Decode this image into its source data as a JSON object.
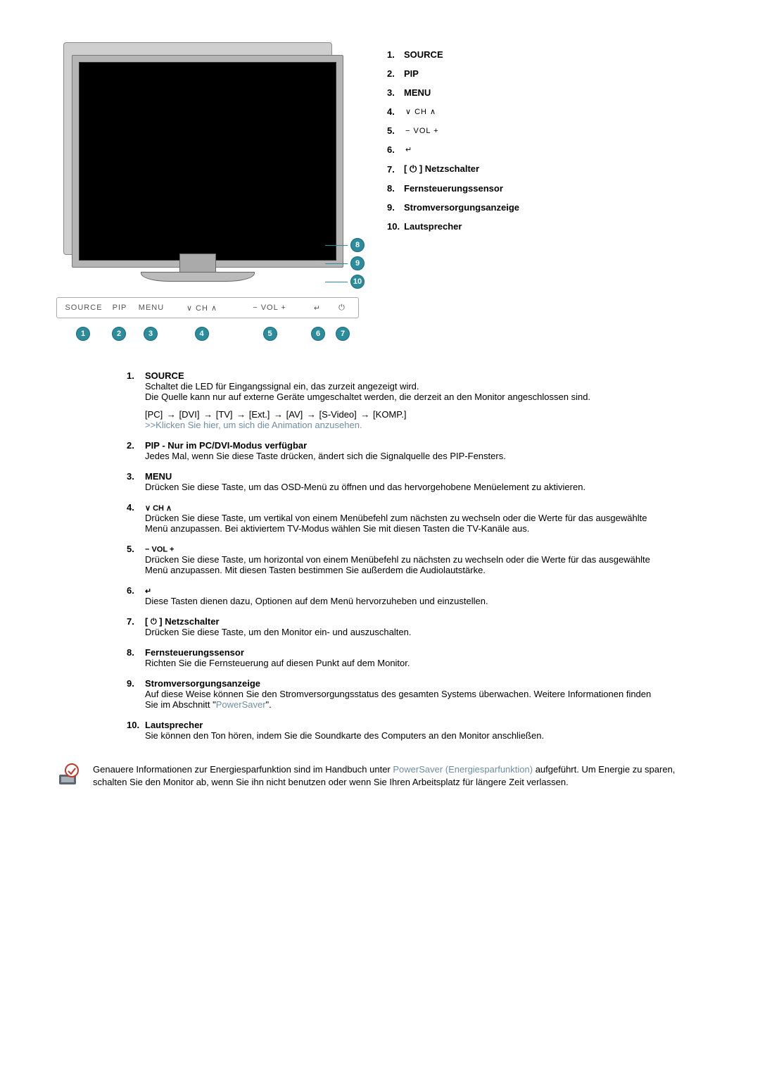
{
  "legend": {
    "items": [
      {
        "num": "1.",
        "label": "SOURCE",
        "bold": true
      },
      {
        "num": "2.",
        "label": "PIP",
        "bold": true
      },
      {
        "num": "3.",
        "label": "MENU",
        "bold": true
      },
      {
        "num": "4.",
        "label": "",
        "sym": "∨  CH  ∧"
      },
      {
        "num": "5.",
        "label": "",
        "sym": "−  VOL  +"
      },
      {
        "num": "6.",
        "label": "",
        "sym": "↵"
      },
      {
        "num": "7.",
        "label": "[  ⏻  ] Netzschalter",
        "bold": true,
        "hasPower": true
      },
      {
        "num": "8.",
        "label": "Fernsteuerungssensor",
        "bold": true
      },
      {
        "num": "9.",
        "label": "Stromversorgungsanzeige",
        "bold": true
      },
      {
        "num": "10.",
        "label": "Lautsprecher",
        "bold": true
      }
    ]
  },
  "panel": {
    "source": "SOURCE",
    "pip": "PIP",
    "menu": "MENU",
    "ch": "∨   CH   ∧",
    "vol": "−    VOL   +",
    "enter": "↵",
    "power": "⏻"
  },
  "badges": {
    "b1": "1",
    "b2": "2",
    "b3": "3",
    "b4": "4",
    "b5": "5",
    "b6": "6",
    "b7": "7",
    "b8": "8",
    "b9": "9",
    "b10": "10"
  },
  "desc": {
    "1": {
      "num": "1.",
      "title": "SOURCE",
      "l1": "Schaltet die LED für Eingangssignal ein, das zurzeit angezeigt wird.",
      "l2": "Die Quelle kann nur auf externe Geräte umgeschaltet werden, die derzeit an den Monitor angeschlossen sind.",
      "chain_pc": "[PC]",
      "chain_dvi": "[DVI]",
      "chain_tv": "[TV]",
      "chain_ext": "[Ext.]",
      "chain_av": "[AV]",
      "chain_sv": "[S-Video]",
      "chain_komp": "[KOMP.]",
      "arrow": "→",
      "link": ">>Klicken Sie hier, um sich die Animation anzusehen."
    },
    "2": {
      "num": "2.",
      "title": "PIP - Nur im PC/DVI-Modus verfügbar",
      "body": "Jedes Mal, wenn Sie diese Taste drücken, ändert sich die Signalquelle des PIP-Fensters."
    },
    "3": {
      "num": "3.",
      "title": "MENU",
      "body": "Drücken Sie diese Taste, um das OSD-Menü zu öffnen und das hervorgehobene Menüelement zu aktivieren."
    },
    "4": {
      "num": "4.",
      "sym": "∨  CH  ∧",
      "body": "Drücken Sie diese Taste, um vertikal von einem Menübefehl zum nächsten zu wechseln oder die Werte für das ausgewählte Menü anzupassen. Bei aktiviertem TV-Modus wählen Sie mit diesen Tasten die TV-Kanäle aus."
    },
    "5": {
      "num": "5.",
      "sym": "−  VOL  +",
      "body": "Drücken Sie diese Taste, um horizontal von einem Menübefehl zu nächsten zu wechseln oder die Werte für das ausgewählte Menü anzupassen. Mit diesen Tasten bestimmen Sie außerdem die Audiolautstärke."
    },
    "6": {
      "num": "6.",
      "sym": "↵",
      "body": "Diese Tasten dienen dazu, Optionen auf dem Menü hervorzuheben und einzustellen."
    },
    "7": {
      "num": "7.",
      "title_open": "[ ",
      "title_close": " ] Netzschalter",
      "body": "Drücken Sie diese Taste, um den Monitor ein- und auszuschalten."
    },
    "8": {
      "num": "8.",
      "title": "Fernsteuerungssensor",
      "body": "Richten Sie die Fernsteuerung auf diesen Punkt auf dem Monitor."
    },
    "9": {
      "num": "9.",
      "title": "Stromversorgungsanzeige",
      "body_a": "Auf diese Weise können Sie den Stromversorgungsstatus des gesamten Systems überwachen. Weitere Informationen finden Sie im Abschnitt \"",
      "link": "PowerSaver",
      "body_b": "\"."
    },
    "10": {
      "num": "10.",
      "title": "Lautsprecher",
      "body": "Sie können den Ton hören, indem Sie die Soundkarte des Computers an den Monitor anschließen."
    }
  },
  "note": {
    "text_a": "Genauere Informationen zur Energiesparfunktion sind im Handbuch unter ",
    "link": "PowerSaver (Energiesparfunktion)",
    "text_b": " aufgeführt. Um Energie zu sparen, schalten Sie den Monitor ab, wenn Sie ihn nicht benutzen oder wenn Sie Ihren Arbeitsplatz für längere Zeit verlassen."
  }
}
